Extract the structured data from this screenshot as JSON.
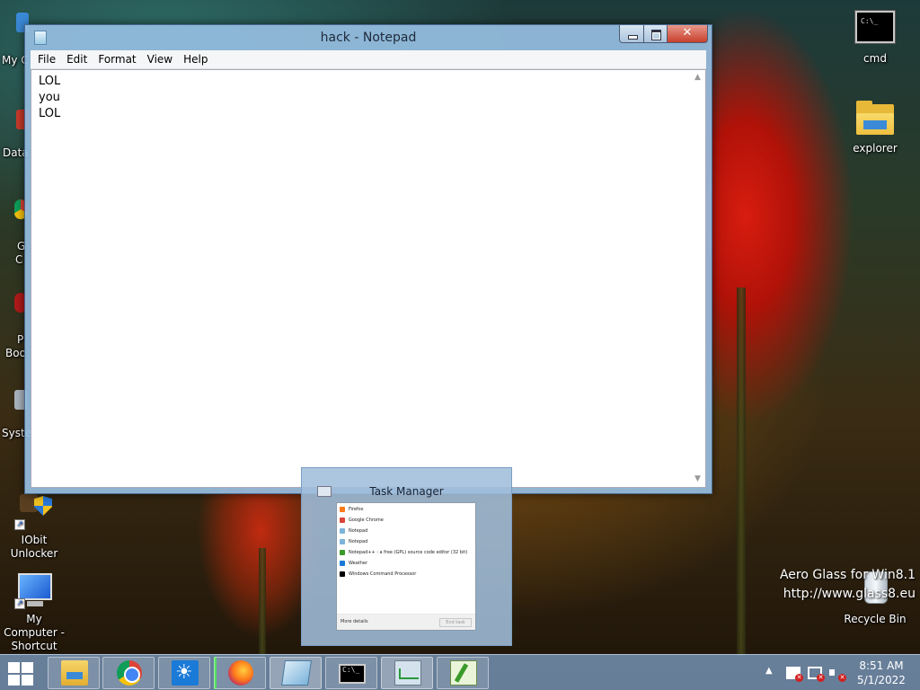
{
  "notepad": {
    "title": "hack - Notepad",
    "close_glyph": "✕",
    "menu": [
      "File",
      "Edit",
      "Format",
      "View",
      "Help"
    ],
    "content_lines": [
      "LOL",
      "you",
      "LOL"
    ]
  },
  "desktop": {
    "icons_left": [
      {
        "label": "IObit Unlocker",
        "icon": "iobit-unlocker-icon"
      },
      {
        "label": "My Computer - Shortcut",
        "icon": "monitor-icon"
      }
    ],
    "icons_right": [
      {
        "label": "cmd",
        "icon": "cmd-icon"
      },
      {
        "label": "explorer",
        "icon": "folder-icon"
      },
      {
        "label": "Recycle Bin",
        "icon": "recycle-bin-icon"
      }
    ],
    "partial_labels": [
      "My C",
      "Data",
      "G",
      "C",
      "P",
      "Boo",
      "Syste"
    ],
    "watermark": [
      "Aero Glass for Win8.1",
      "http://www.glass8.eu"
    ]
  },
  "task_manager_preview": {
    "title": "Task Manager",
    "apps": [
      {
        "name": "Firefox",
        "color": "#ff7a1a"
      },
      {
        "name": "Google Chrome",
        "color": "#db4437"
      },
      {
        "name": "Notepad",
        "color": "#7cb4dc"
      },
      {
        "name": "Notepad",
        "color": "#7cb4dc"
      },
      {
        "name": "Notepad++ : a free (GPL) source code editor (32 bit)",
        "color": "#3a9a2a"
      },
      {
        "name": "Weather",
        "color": "#1a7ad8"
      },
      {
        "name": "Windows Command Processor",
        "color": "#000000"
      }
    ],
    "more_details": "More details",
    "end_task": "End task"
  },
  "taskbar": {
    "pinned": [
      "file-explorer",
      "google-chrome",
      "weather",
      "firefox",
      "notepad",
      "command-prompt",
      "task-manager",
      "notepad-plus-plus"
    ],
    "clock_time": "8:51 AM",
    "clock_date": "5/1/2022"
  },
  "colors": {
    "accent": "#7aa0c8",
    "close_red": "#c8402c"
  }
}
